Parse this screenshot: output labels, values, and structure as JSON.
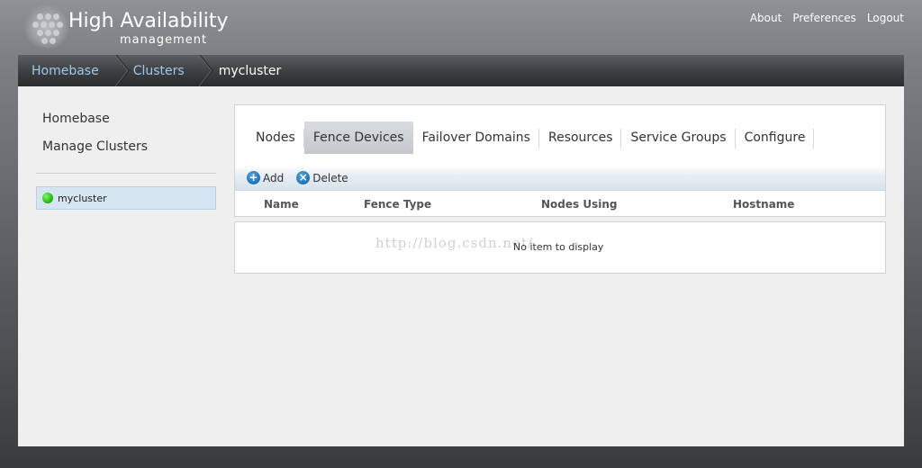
{
  "header": {
    "logo_title": "High Availability",
    "logo_subtitle": "management",
    "links": [
      "About",
      "Preferences",
      "Logout"
    ]
  },
  "breadcrumb": {
    "items": [
      "Homebase",
      "Clusters",
      "mycluster"
    ]
  },
  "sidebar": {
    "links": [
      "Homebase",
      "Manage Clusters"
    ],
    "cluster": {
      "name": "mycluster",
      "status_color": "#2fbf14"
    }
  },
  "tabs": {
    "items": [
      "Nodes",
      "Fence Devices",
      "Failover Domains",
      "Resources",
      "Service Groups",
      "Configure"
    ],
    "active": "Fence Devices"
  },
  "toolbar": {
    "add_label": "Add",
    "delete_label": "Delete"
  },
  "table": {
    "columns": [
      "Name",
      "Fence Type",
      "Nodes Using",
      "Hostname"
    ],
    "empty_message": "No item to display"
  },
  "watermark": "http://blog.csdn.net/"
}
